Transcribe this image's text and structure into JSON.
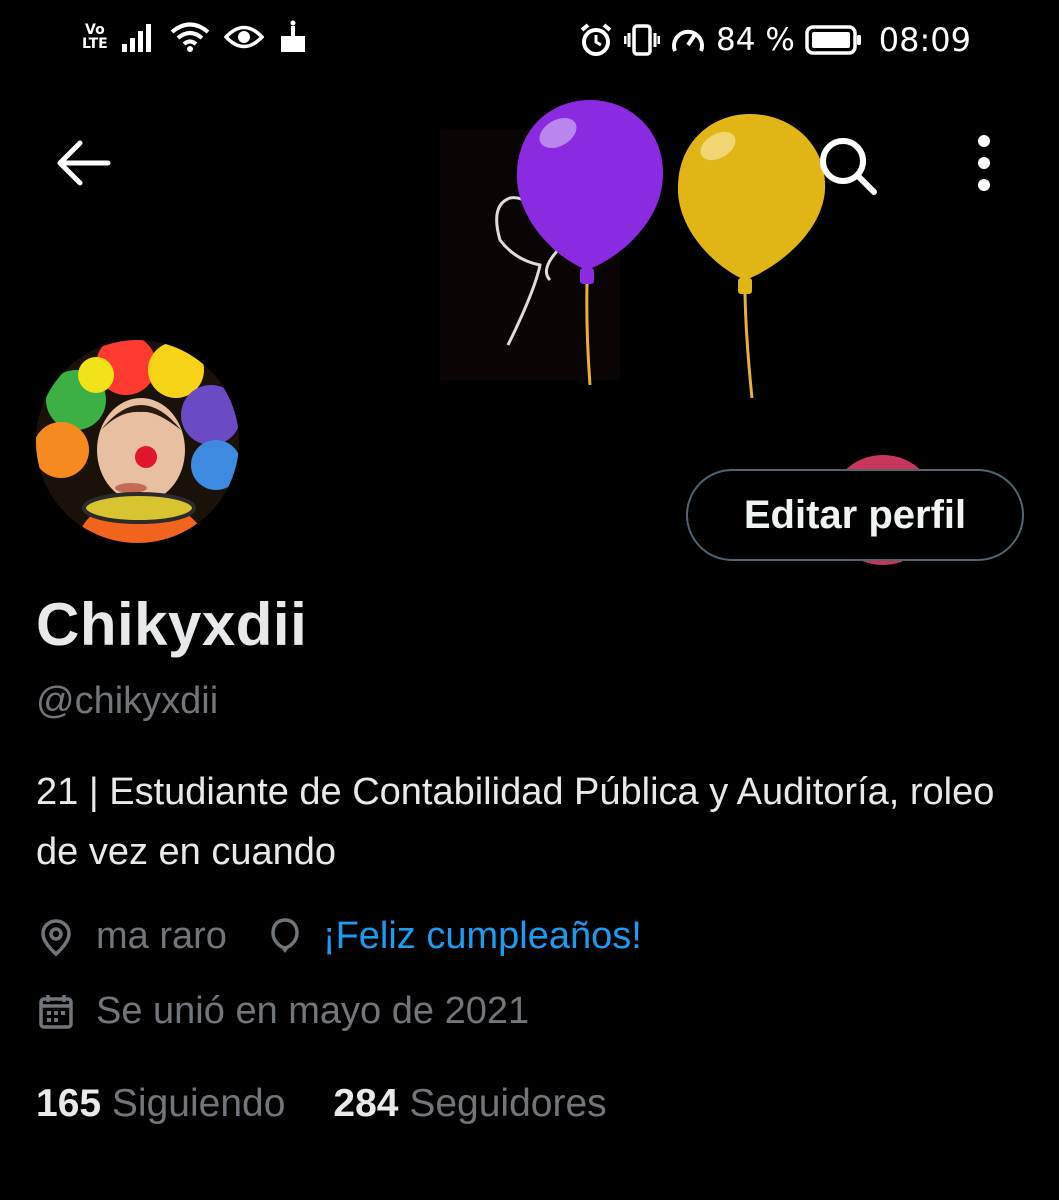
{
  "status_bar": {
    "network_top": "Vo",
    "network_bottom": "LTE",
    "battery_percent": "84 %",
    "time": "08:09"
  },
  "header": {
    "back_icon": "arrow-left-icon",
    "search_icon": "search-icon",
    "more_icon": "more-vertical-icon",
    "banner_colors": {
      "purple_balloon": "#8a2be2",
      "yellow_balloon": "#e0b515"
    }
  },
  "profile": {
    "edit_button": "Editar perfil",
    "display_name": "Chikyxdii",
    "handle": "@chikyxdii",
    "bio": "21 | Estudiante de Contabilidad Pública y Auditoría, roleo de vez en cuando",
    "location_icon": "location-pin-icon",
    "location": "ma raro",
    "birthday_icon": "balloon-icon",
    "birthday": "¡Feliz cumpleaños!",
    "joined_icon": "calendar-icon",
    "joined": "Se unió en mayo de 2021",
    "following_count": "165",
    "following_label": "Siguiendo",
    "followers_count": "284",
    "followers_label": "Seguidores"
  },
  "colors": {
    "background": "#000000",
    "primary_text": "#e7e9ea",
    "secondary_text": "#71767b",
    "accent_link": "#1d9bf0",
    "button_border": "#536471"
  }
}
